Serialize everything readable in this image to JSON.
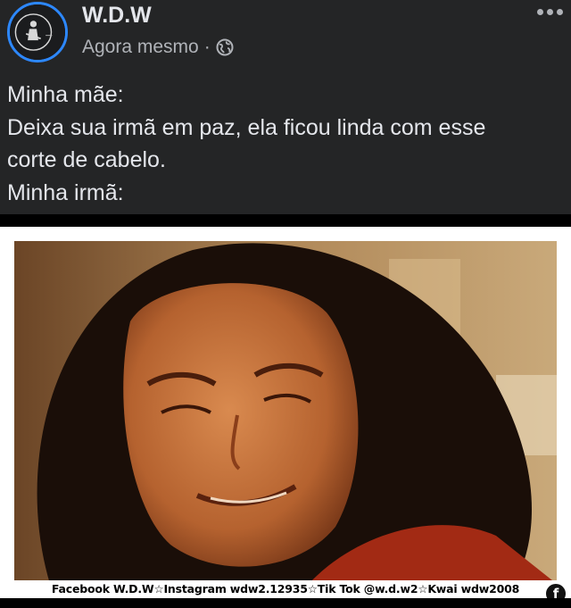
{
  "post": {
    "author": "W.D.W",
    "timestamp": "Agora mesmo",
    "separator": "·",
    "privacy_icon": "globe-icon",
    "more_icon": "more-options-icon",
    "text_lines": [
      "Minha mãe:",
      "Deixa sua irmã em paz, ela ficou linda com esse",
      "corte de cabelo.",
      "Minha irmã:"
    ]
  },
  "image": {
    "watermark": "Facebook W.D.W☆Instagram wdw2.12935☆Tik Tok @w.d.w2☆Kwai wdw2008",
    "badge_letter": "f"
  },
  "colors": {
    "background": "#242526",
    "text": "#e4e6eb",
    "secondary_text": "#b0b3b8",
    "avatar_ring": "#2d88ff"
  }
}
